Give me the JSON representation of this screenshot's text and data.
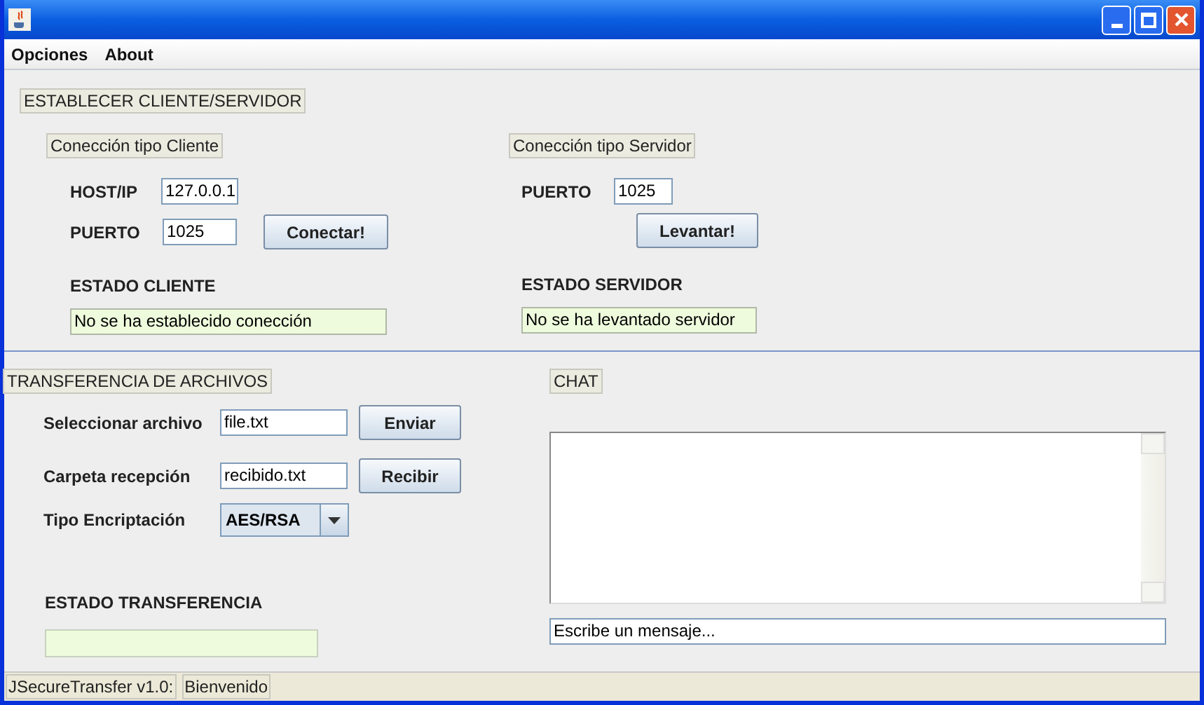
{
  "menu": [
    "Opciones",
    "About"
  ],
  "connection": {
    "title": "ESTABLECER CLIENTE/SERVIDOR",
    "client": {
      "title": "Conección tipo Cliente",
      "host_label": "HOST/IP",
      "host": "127.0.0.1",
      "port_label": "PUERTO",
      "port": "1025",
      "button": "Conectar!",
      "status_label": "ESTADO CLIENTE",
      "status": "No se ha establecido conección"
    },
    "server": {
      "title": "Conección tipo Servidor",
      "port_label": "PUERTO",
      "port": "1025",
      "button": "Levantar!",
      "status_label": "ESTADO SERVIDOR",
      "status": "No se ha levantado servidor"
    }
  },
  "transfer": {
    "title": "TRANSFERENCIA DE ARCHIVOS",
    "rows": [
      {
        "label": "Seleccionar archivo",
        "value": "file.txt",
        "button": "Enviar"
      },
      {
        "label": "Carpeta recepción",
        "value": "recibido.txt",
        "button": "Recibir"
      }
    ],
    "encryption_label": "Tipo Encriptación",
    "encryption": "AES/RSA",
    "status_label": "ESTADO TRANSFERENCIA"
  },
  "chat": {
    "title": "CHAT",
    "message": "Escribe un mensaje..."
  },
  "status_bar": [
    "JSecureTransfer v1.0:",
    "Bienvenido"
  ]
}
